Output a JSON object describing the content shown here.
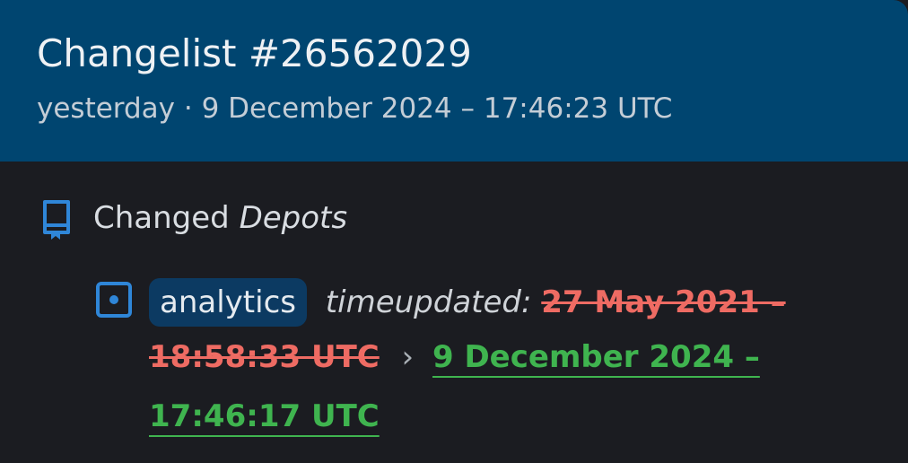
{
  "header": {
    "title": "Changelist #26562029",
    "date": "yesterday · 9 December 2024 – 17:46:23 UTC"
  },
  "section": {
    "icon": "book-icon",
    "title_prefix": "Changed",
    "title_emphasis": "Depots"
  },
  "change": {
    "icon": "depot-square-icon",
    "depot": "analytics",
    "key": "timeupdated:",
    "old_value_part1": "27 May 2021 –",
    "old_value_part2": "18:58:33 UTC",
    "separator": "›",
    "new_value_part1": "9 December 2024 –",
    "new_value_part2": "17:46:17 UTC"
  },
  "colors": {
    "header_bg": "#004570",
    "body_bg": "#1b1c21",
    "old_value": "#ee6b63",
    "new_value": "#3fb44f",
    "accent_icon": "#2f86d8",
    "pill_bg": "#0c3a62"
  }
}
